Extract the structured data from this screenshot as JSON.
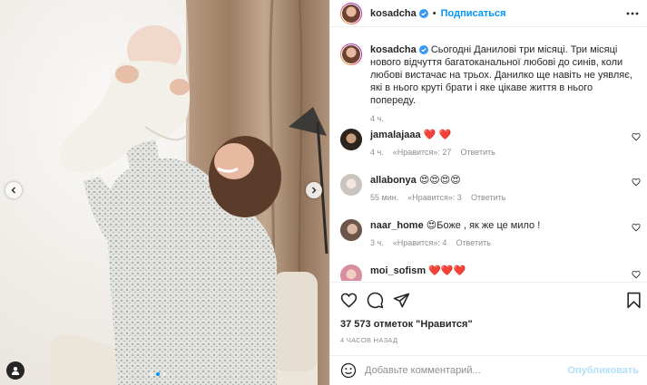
{
  "author": {
    "username": "kosadcha",
    "follow_label": "Подписаться",
    "dot": "•",
    "avatar_color": "#c98a6e"
  },
  "caption": {
    "username": "kosadcha",
    "text": "Сьогодні Данилові три місяці. Три місяці нового відчуття багатоканальної любові до синів, коли любові вистачає на трьох. Данилко ще навіть не уявляє, які в нього круті брати і яке цікаве життя в нього попереду.",
    "time": "4 ч."
  },
  "comments": [
    {
      "username": "jamalajaaa",
      "text": "❤️ ❤️",
      "time": "4 ч.",
      "likes": "«Нравится»: 27",
      "reply": "Ответить",
      "avatar_color": "#3a3228"
    },
    {
      "username": "allabonya",
      "text": "😍😍😍😍",
      "time": "55 мин.",
      "likes": "«Нравится»: 3",
      "reply": "Ответить",
      "avatar_color": "#d7d4d0"
    },
    {
      "username": "naar_home",
      "text": "😍Боже , як же це мило !",
      "time": "3 ч.",
      "likes": "«Нравится»: 4",
      "reply": "Ответить",
      "avatar_color": "#8a6f62"
    },
    {
      "username": "moi_sofism",
      "text": "❤️❤️❤️",
      "time": "",
      "likes": "",
      "reply": "",
      "avatar_color": "#e9a9b8"
    }
  ],
  "stats": {
    "likes": "37 573 отметок \"Нравится\"",
    "ago": "4 ЧАСОВ НАЗАД"
  },
  "composer": {
    "placeholder": "Добавьте комментарий...",
    "publish": "Опубликовать"
  },
  "carousel": {
    "slides": 3,
    "active": 2
  },
  "colors": {
    "accent": "#0095f6",
    "verified": "#3897f0",
    "muted": "#8e8e8e",
    "heart_red": "#ed4956"
  },
  "icons": [
    "chevron-left-icon",
    "chevron-right-icon",
    "user-tag-icon",
    "more-icon",
    "heart-icon",
    "comment-icon",
    "share-icon",
    "bookmark-icon",
    "emoji-icon",
    "verified-icon"
  ]
}
